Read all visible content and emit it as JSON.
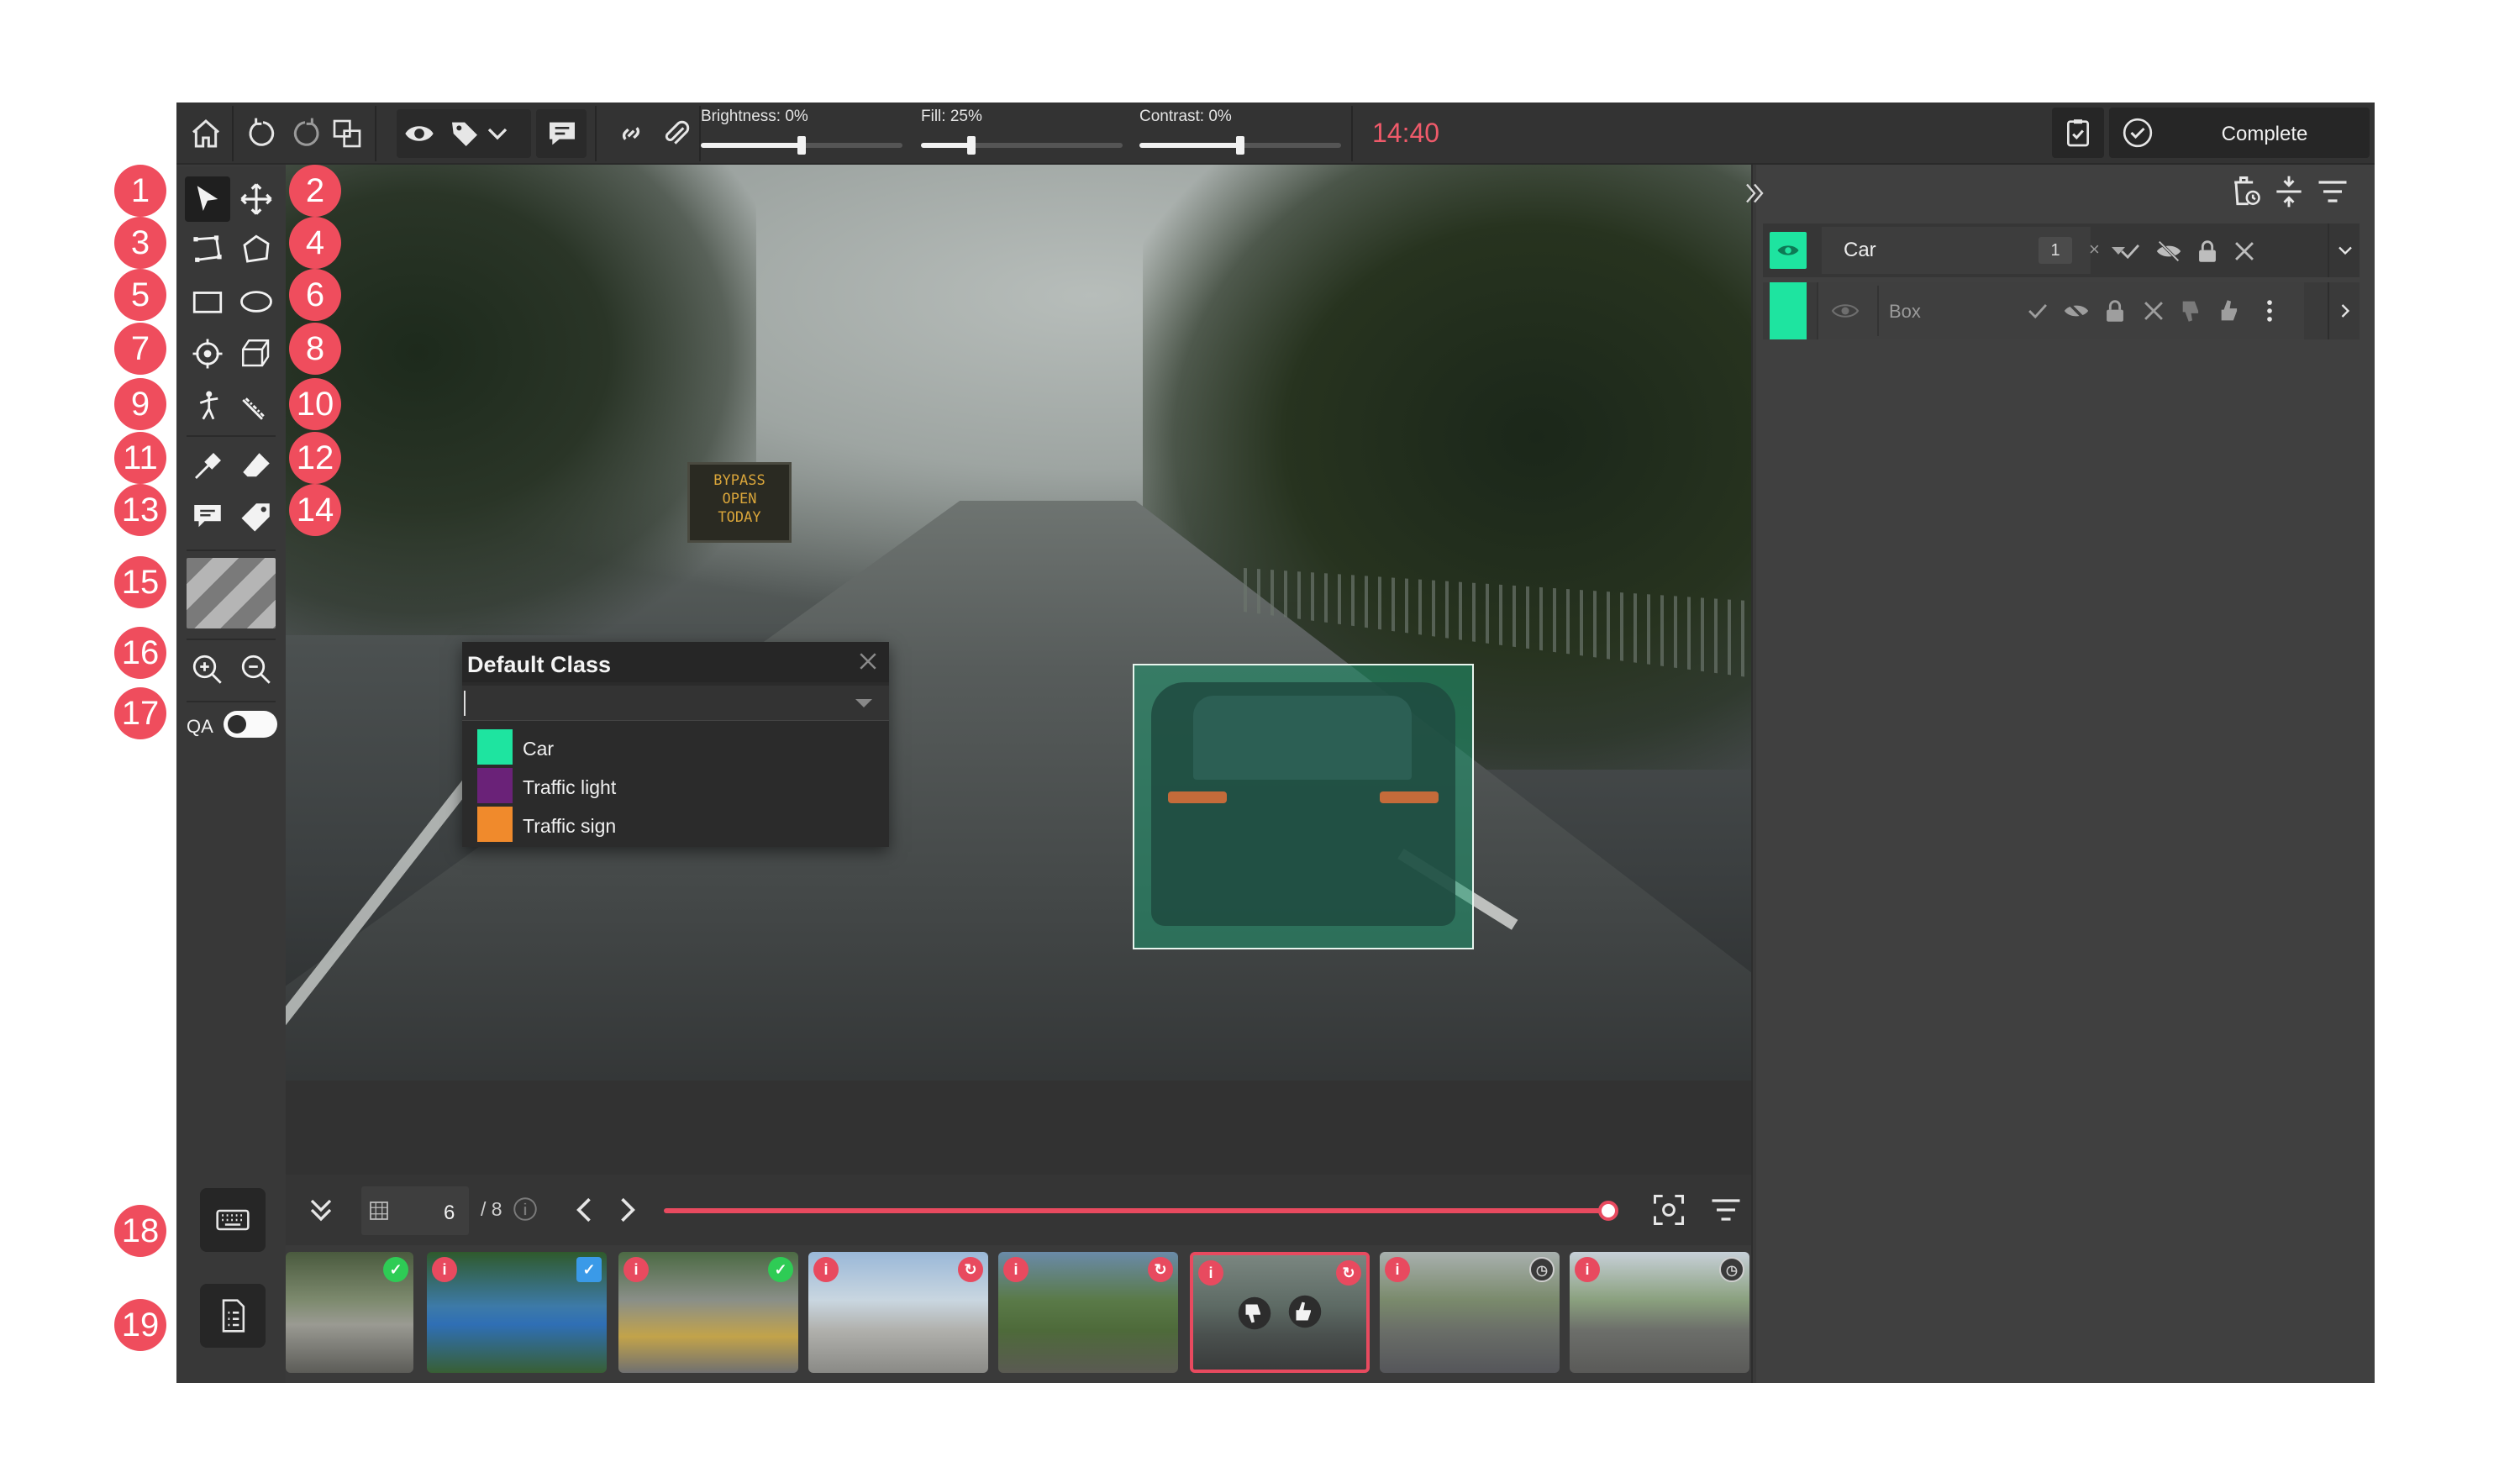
{
  "topbar": {
    "sliders": [
      {
        "label": "Brightness: 0%",
        "value": 0.5
      },
      {
        "label": "Fill: 25%",
        "value": 0.25
      },
      {
        "label": "Contrast: 0%",
        "value": 0.5
      }
    ],
    "timer": "14:40",
    "complete_label": "Complete"
  },
  "tool_markers": [
    "1",
    "2",
    "3",
    "4",
    "5",
    "6",
    "7",
    "8",
    "9",
    "10",
    "11",
    "12",
    "13",
    "14",
    "15",
    "16",
    "17",
    "18",
    "19"
  ],
  "left_toolbar": {
    "qa_label": "QA",
    "qa_toggle_on": false
  },
  "canvas": {
    "sign_text": [
      "BYPASS",
      "OPEN",
      "TODAY"
    ]
  },
  "class_picker": {
    "title": "Default Class",
    "classes": [
      {
        "name": "Car",
        "color": "#1ee4a0"
      },
      {
        "name": "Traffic light",
        "color": "#6a2278"
      },
      {
        "name": "Traffic sign",
        "color": "#f08a2c"
      }
    ]
  },
  "objects_panel": {
    "class_name": "Car",
    "class_count": "1",
    "class_color": "#1ee4a0",
    "instance_name": "Box"
  },
  "player": {
    "current_frame": "6",
    "total_frames": "/ 8",
    "progress": 1.0
  },
  "filmstrip": {
    "thumbnails": [
      {
        "status": "approved"
      },
      {
        "status": "info-submitted"
      },
      {
        "status": "info-approved"
      },
      {
        "status": "info-rejected"
      },
      {
        "status": "info-rejected"
      },
      {
        "status": "info-rejected",
        "active": true
      },
      {
        "status": "info-pending"
      },
      {
        "status": "info-pending"
      }
    ]
  },
  "colors": {
    "accent_red": "#e84a5f",
    "class_green": "#1ee4a0",
    "panel_bg": "#3a3a3a"
  }
}
